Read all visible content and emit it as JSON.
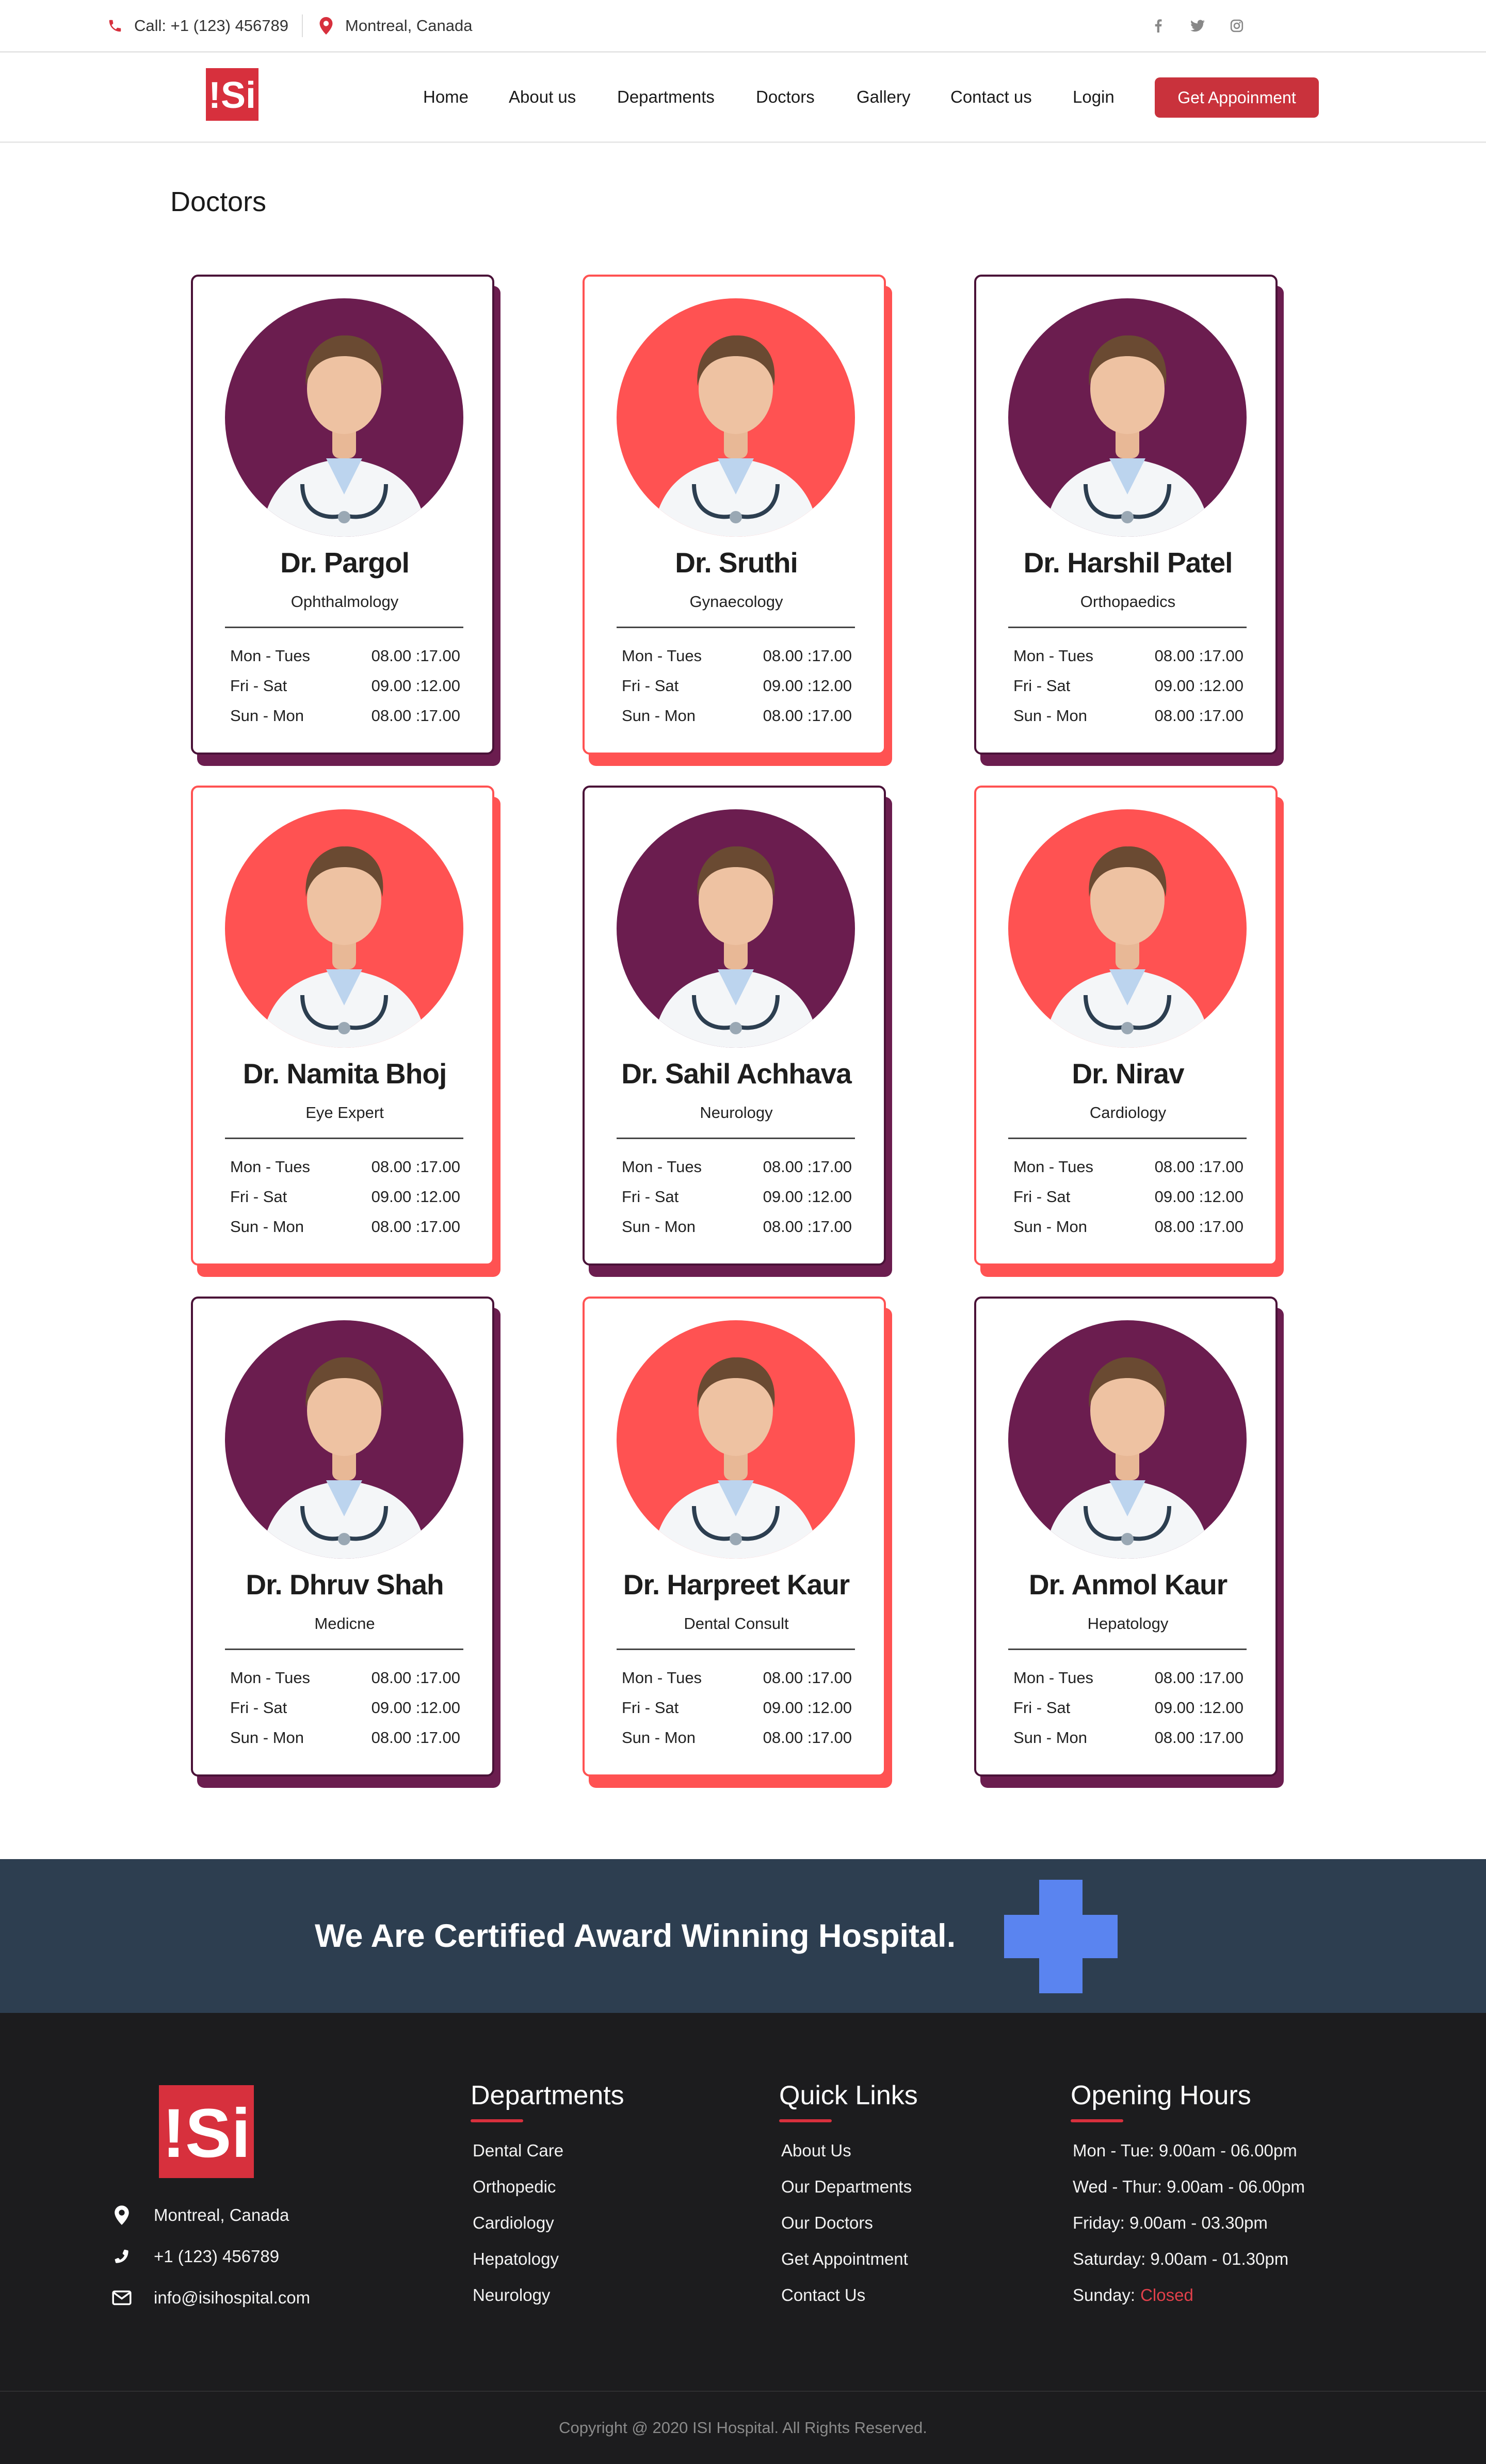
{
  "topbar": {
    "phone": "Call: +1 (123) 456789",
    "location": "Montreal, Canada",
    "social_icons": [
      "facebook-icon",
      "twitter-icon",
      "instagram-icon"
    ]
  },
  "nav": {
    "logo_text": "!Si",
    "links": [
      "Home",
      "About us",
      "Departments",
      "Doctors",
      "Gallery",
      "Contact us",
      "Login"
    ],
    "cta": "Get Appoinment"
  },
  "section": {
    "title": "Doctors"
  },
  "colors": {
    "brand_red": "#d7303d",
    "accent_coral": "#ff5252",
    "accent_plum": "#6b1d4f",
    "banner_bg": "#2d3e50",
    "cross_blue": "#5a84f0",
    "footer_bg": "#1c1c1e"
  },
  "doctors": [
    {
      "name": "Dr. Pargol",
      "specialty": "Ophthalmology",
      "theme": "plum",
      "schedule": [
        [
          "Mon - Tues",
          "08.00 :17.00"
        ],
        [
          "Fri - Sat",
          "09.00 :12.00"
        ],
        [
          "Sun - Mon",
          "08.00 :17.00"
        ]
      ]
    },
    {
      "name": "Dr. Sruthi",
      "specialty": "Gynaecology",
      "theme": "coral",
      "schedule": [
        [
          "Mon - Tues",
          "08.00 :17.00"
        ],
        [
          "Fri - Sat",
          "09.00 :12.00"
        ],
        [
          "Sun - Mon",
          "08.00 :17.00"
        ]
      ]
    },
    {
      "name": "Dr. Harshil Patel",
      "specialty": "Orthopaedics",
      "theme": "plum",
      "schedule": [
        [
          "Mon - Tues",
          "08.00 :17.00"
        ],
        [
          "Fri - Sat",
          "09.00 :12.00"
        ],
        [
          "Sun - Mon",
          "08.00 :17.00"
        ]
      ]
    },
    {
      "name": "Dr. Namita Bhoj",
      "specialty": "Eye Expert",
      "theme": "coral",
      "schedule": [
        [
          "Mon - Tues",
          "08.00 :17.00"
        ],
        [
          "Fri - Sat",
          "09.00 :12.00"
        ],
        [
          "Sun - Mon",
          "08.00 :17.00"
        ]
      ]
    },
    {
      "name": "Dr. Sahil Achhava",
      "specialty": "Neurology",
      "theme": "plum",
      "schedule": [
        [
          "Mon - Tues",
          "08.00 :17.00"
        ],
        [
          "Fri - Sat",
          "09.00 :12.00"
        ],
        [
          "Sun - Mon",
          "08.00 :17.00"
        ]
      ]
    },
    {
      "name": "Dr. Nirav",
      "specialty": "Cardiology",
      "theme": "coral",
      "schedule": [
        [
          "Mon - Tues",
          "08.00 :17.00"
        ],
        [
          "Fri - Sat",
          "09.00 :12.00"
        ],
        [
          "Sun - Mon",
          "08.00 :17.00"
        ]
      ]
    },
    {
      "name": "Dr. Dhruv Shah",
      "specialty": "Medicne",
      "theme": "plum",
      "schedule": [
        [
          "Mon - Tues",
          "08.00 :17.00"
        ],
        [
          "Fri - Sat",
          "09.00 :12.00"
        ],
        [
          "Sun - Mon",
          "08.00 :17.00"
        ]
      ]
    },
    {
      "name": "Dr. Harpreet Kaur",
      "specialty": "Dental Consult",
      "theme": "coral",
      "schedule": [
        [
          "Mon - Tues",
          "08.00 :17.00"
        ],
        [
          "Fri - Sat",
          "09.00 :12.00"
        ],
        [
          "Sun - Mon",
          "08.00 :17.00"
        ]
      ]
    },
    {
      "name": "Dr. Anmol Kaur",
      "specialty": "Hepatology",
      "theme": "plum",
      "schedule": [
        [
          "Mon - Tues",
          "08.00 :17.00"
        ],
        [
          "Fri - Sat",
          "09.00 :12.00"
        ],
        [
          "Sun - Mon",
          "08.00 :17.00"
        ]
      ]
    }
  ],
  "banner": {
    "text": "We Are Certified Award Winning Hospital."
  },
  "footer": {
    "logo_text": "!Si",
    "address": "Montreal, Canada",
    "phone": "+1 (123) 456789",
    "email": "info@isihospital.com",
    "departments": {
      "title": "Departments",
      "items": [
        "Dental Care",
        "Orthopedic",
        "Cardiology",
        "Hepatology",
        "Neurology"
      ]
    },
    "quick_links": {
      "title": "Quick Links",
      "items": [
        "About Us",
        "Our Departments",
        "Our Doctors",
        "Get Appointment",
        "Contact Us"
      ]
    },
    "hours": {
      "title": "Opening Hours",
      "items": [
        "Mon - Tue: 9.00am - 06.00pm",
        "Wed - Thur: 9.00am - 06.00pm",
        "Friday: 9.00am - 03.30pm",
        "Saturday: 9.00am - 01.30pm"
      ],
      "sunday_label": "Sunday:",
      "sunday_value": "Closed"
    },
    "copyright": "Copyright @ 2020 ISI Hospital. All Rights Reserved."
  }
}
